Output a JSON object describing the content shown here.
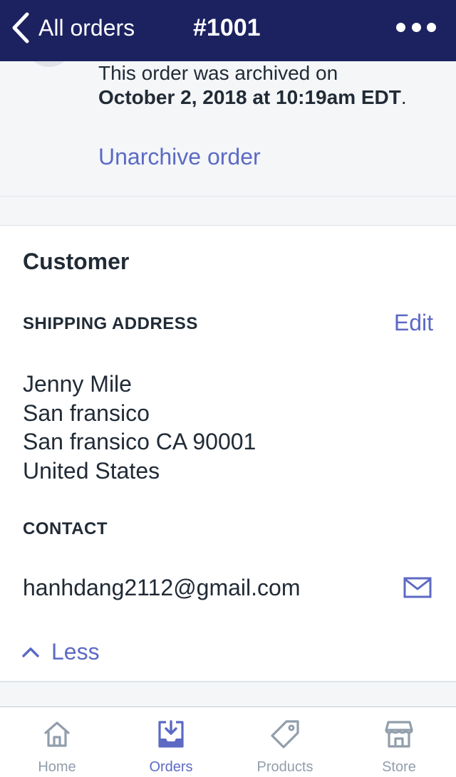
{
  "colors": {
    "nav_background": "#1c2260",
    "accent": "#5c6ac4",
    "text": "#212b36",
    "muted": "#919eab",
    "page_background": "#f4f6f8"
  },
  "navbar": {
    "back_label": "All orders",
    "back_icon": "chevron-left-icon",
    "title": "#1001",
    "more_icon": "more-horizontal-icon"
  },
  "archive": {
    "message_line1": "This order was archived on",
    "message_date": "October 2, 2018 at 10:19am EDT",
    "message_period": ".",
    "unarchive_label": "Unarchive order"
  },
  "customer": {
    "title": "Customer",
    "shipping_heading": "SHIPPING ADDRESS",
    "edit_label": "Edit",
    "address_lines": [
      "Jenny Mile",
      "San fransico",
      "San fransico CA 90001",
      "United States"
    ],
    "contact_heading": "CONTACT",
    "email": "hanhdang2112@gmail.com",
    "email_icon": "mail-icon",
    "less_label": "Less",
    "less_icon": "chevron-up-icon"
  },
  "tabbar": {
    "tabs": [
      {
        "label": "Home",
        "icon": "home-icon",
        "active": false
      },
      {
        "label": "Orders",
        "icon": "orders-inbox-icon",
        "active": true
      },
      {
        "label": "Products",
        "icon": "tag-icon",
        "active": false
      },
      {
        "label": "Store",
        "icon": "store-icon",
        "active": false
      }
    ]
  }
}
